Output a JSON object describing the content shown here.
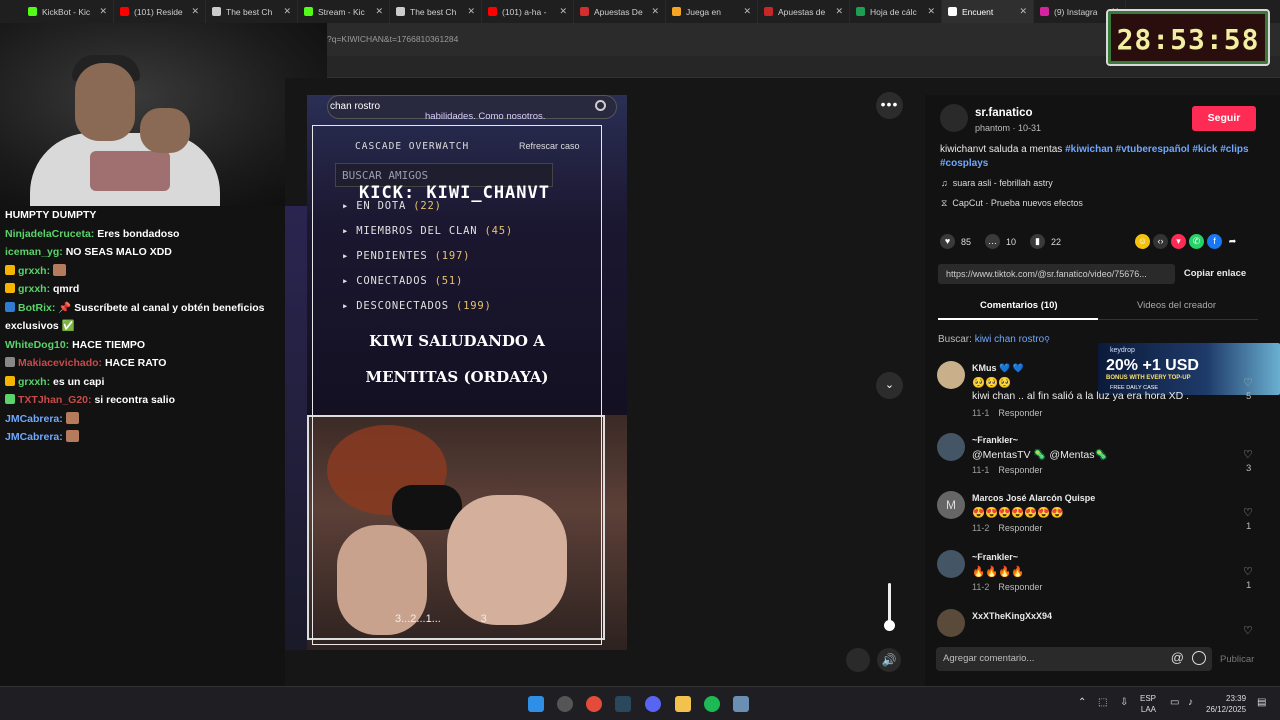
{
  "browser": {
    "tabs": [
      {
        "label": "KickBot - Kic",
        "color": "#53fc18"
      },
      {
        "label": "(101) Reside",
        "color": "#ff0000"
      },
      {
        "label": "The best Ch",
        "color": "#cccccc"
      },
      {
        "label": "Stream - Kic",
        "color": "#53fc18"
      },
      {
        "label": "The best Ch",
        "color": "#cccccc"
      },
      {
        "label": "(101) a-ha -",
        "color": "#ff0000"
      },
      {
        "label": "Apuestas De",
        "color": "#d32f2f"
      },
      {
        "label": "Juega en",
        "color": "#f4a623"
      },
      {
        "label": "Apuestas de",
        "color": "#c62828"
      },
      {
        "label": "Hoja de cálc",
        "color": "#1e9e55"
      },
      {
        "label": "Encuent",
        "color": "#ffffff"
      },
      {
        "label": "(9) Instagra",
        "color": "#d6249f"
      }
    ],
    "url_fragment": "?q=KIWICHAN&t=1766810361284"
  },
  "timer": "28:53:58",
  "chat": [
    {
      "user": "",
      "text": "HUMPTY DUMPTY",
      "color": "#ffffff",
      "badge": ""
    },
    {
      "user": "NinjadelaCruceta:",
      "text": "Eres bondadoso",
      "color": "#59d36a",
      "badge": ""
    },
    {
      "user": "iceman_yg:",
      "text": "NO SEAS MALO XDD",
      "color": "#59d36a",
      "badge": ""
    },
    {
      "user": "grxxh:",
      "text": "",
      "color": "#59d36a",
      "badge": "#f4b400",
      "emote": true
    },
    {
      "user": "grxxh:",
      "text": "qmrd",
      "color": "#59d36a",
      "badge": "#f4b400"
    },
    {
      "user": "BotRix:",
      "text": "📌 Suscríbete al canal y obtén beneficios exclusivos ✅",
      "color": "#59d36a",
      "badge": "#2f7dd3"
    },
    {
      "user": "WhiteDog10:",
      "text": "HACE TIEMPO",
      "color": "#59d36a",
      "badge": ""
    },
    {
      "user": "Makiacevichado:",
      "text": "HACE RATO",
      "color": "#c94a4a",
      "badge": "#888888"
    },
    {
      "user": "grxxh:",
      "text": "es un capi",
      "color": "#59d36a",
      "badge": "#f4b400"
    },
    {
      "user": "TXTJhan_G20:",
      "text": "si recontra salio",
      "color": "#c94a4a",
      "badge": "#59d36a"
    },
    {
      "user": "JMCabrera:",
      "text": "",
      "color": "#6ea8ff",
      "badge": "",
      "emote": true
    },
    {
      "user": "JMCabrera:",
      "text": "",
      "color": "#6ea8ff",
      "badge": "",
      "emote": true
    }
  ],
  "video": {
    "search_text": "chan rostro",
    "habilidades": "habilidades. Como nosotros.",
    "overwatch": "CASCADE OVERWATCH",
    "refresh": "Refrescar caso",
    "buscar_amigos": "BUSCAR AMIGOS",
    "kick_title": "KICK: KIWI_CHANVT",
    "rows": [
      {
        "label": "EN DOTA",
        "count": "(22)"
      },
      {
        "label": "MIEMBROS DEL CLAN",
        "count": "(45)"
      },
      {
        "label": "PENDIENTES",
        "count": "(197)"
      },
      {
        "label": "CONECTADOS",
        "count": "(51)"
      },
      {
        "label": "DESCONECTADOS",
        "count": "(199)"
      }
    ],
    "caption_line1": "KIWI SALUDANDO A",
    "caption_line2": "MENTITAS (ORDAYA)",
    "countdown": "3...2...1...",
    "countdown_end": "3"
  },
  "post": {
    "author": "sr.fanatico",
    "author_sub": "phantom · 10-31",
    "follow_label": "Seguir",
    "desc_text": "kiwichanvt saluda a mentas",
    "tags": [
      "#kiwichan",
      "#vtuberespañol",
      "#kick",
      "#clips",
      "#cosplays"
    ],
    "music": "suara asli - febrillah astry",
    "capcut": "CapCut · Prueba nuevos efectos",
    "likes": "85",
    "comments": "10",
    "saves": "22",
    "link": "https://www.tiktok.com/@sr.fanatico/video/75676...",
    "copy_label": "Copiar enlace",
    "tab_comments": "Comentarios (10)",
    "tab_videos": "Videos del creador",
    "search_label": "Buscar:",
    "search_query": "kiwi chan rostro"
  },
  "ad": {
    "brand": "keydrop",
    "headline": "20% +1 USD",
    "subline": "BONUS WITH EVERY TOP-UP",
    "footer": "FREE DAILY CASE"
  },
  "comments": [
    {
      "name": "KMus 💙 💙",
      "text": "🥺🥺🥺",
      "text2": "kiwi chan .. al fin salió a la luz ya era hora XD .",
      "date": "11-1",
      "reply": "Responder",
      "likes": "5"
    },
    {
      "name": "~Frankler~",
      "text": "@MentasTV 🦠 @Mentas🦠",
      "date": "11-1",
      "reply": "Responder",
      "likes": "3"
    },
    {
      "name": "Marcos José Alarcón Quispe",
      "text": "😍😍😍😍😍😍😍",
      "date": "11-2",
      "reply": "Responder",
      "likes": "1",
      "initial": "M"
    },
    {
      "name": "~Frankler~",
      "text": "🔥🔥🔥🔥",
      "date": "11-2",
      "reply": "Responder",
      "likes": "1"
    },
    {
      "name": "XxXTheKingXxX94",
      "text": "",
      "date": "",
      "reply": "",
      "likes": ""
    }
  ],
  "composer": {
    "placeholder": "Agregar comentario...",
    "publish": "Publicar"
  },
  "taskbar": {
    "lang1": "ESP",
    "lang2": "LAA",
    "time": "23:39",
    "date": "26/12/2025"
  }
}
